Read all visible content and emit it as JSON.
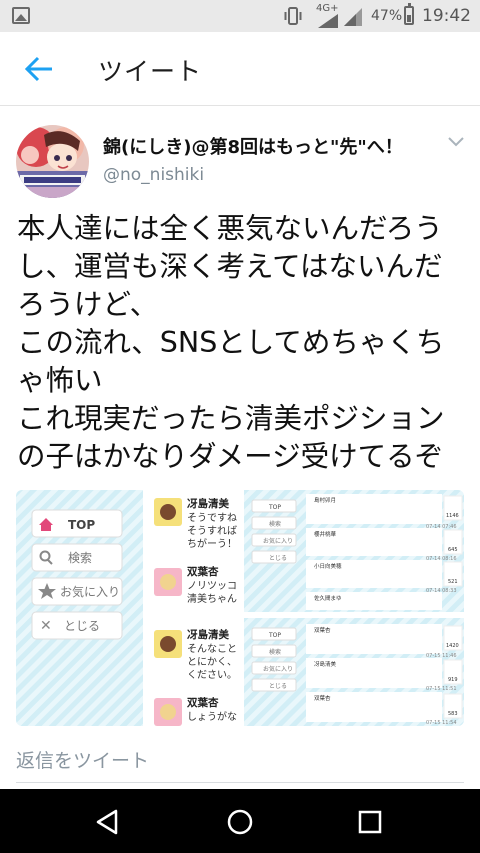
{
  "status_bar": {
    "network": "4G+",
    "battery_percent": "47%",
    "time": "19:42",
    "icons": [
      "gallery-icon",
      "vibrate-icon",
      "signal-icon",
      "battery-icon"
    ]
  },
  "app_bar": {
    "title": "ツイート",
    "back_icon": "back-arrow-icon"
  },
  "tweet": {
    "author_name": "錦(にしき)@第8回はもっと\"先\"へ！",
    "handle": "@no_nishiki",
    "text_lines": [
      "本人達には全く悪気ないんだろう",
      "し、運営も深く考えてはないんだ",
      "ろうけど、",
      "この流れ、SNSとしてめちゃくち",
      "ゃ怖い",
      "これ現実だったら清美ポジション",
      "の子はかなりダメージ受けてるぞ"
    ],
    "media": {
      "menu": {
        "top": "TOP",
        "search": "検索",
        "favorites": "お気に入り",
        "close": "とじる"
      },
      "posts": [
        {
          "name": "冴島清美",
          "text": "そうですね\nそうすれば\nちがーう！"
        },
        {
          "name": "双葉杏",
          "text": "ノリツッコ\n清美ちゃん"
        },
        {
          "name": "冴島清美",
          "text": "そんなこと\nとにかく、\nください。"
        },
        {
          "name": "双葉杏",
          "text": "しょうがな"
        }
      ],
      "mini_menu": {
        "top": "TOP",
        "search": "検索",
        "favorites": "お気に入り",
        "close": "とじる"
      },
      "mini_posts_top": [
        {
          "name": "島村卯月",
          "count": "1146",
          "time": "07-14 07:46"
        },
        {
          "name": "櫻井桃華",
          "count": "645",
          "time": "07-14 08:16"
        },
        {
          "name": "小日向美穂",
          "count": "521",
          "time": "07-14 08:33"
        },
        {
          "name": "佐久間まゆ",
          "count": "",
          "time": ""
        }
      ],
      "mini_posts_bottom": [
        {
          "name": "双葉杏",
          "count": "1420",
          "time": "07-15 11:46"
        },
        {
          "name": "冴島清美",
          "count": "919",
          "time": "07-15 11:51"
        },
        {
          "name": "双葉杏",
          "count": "583",
          "time": "07-15 11:54"
        }
      ]
    }
  },
  "reply_bar": {
    "placeholder": "返信をツイート"
  },
  "nav_bar": {
    "icons": [
      "back-triangle-icon",
      "home-circle-icon",
      "recents-square-icon"
    ]
  }
}
